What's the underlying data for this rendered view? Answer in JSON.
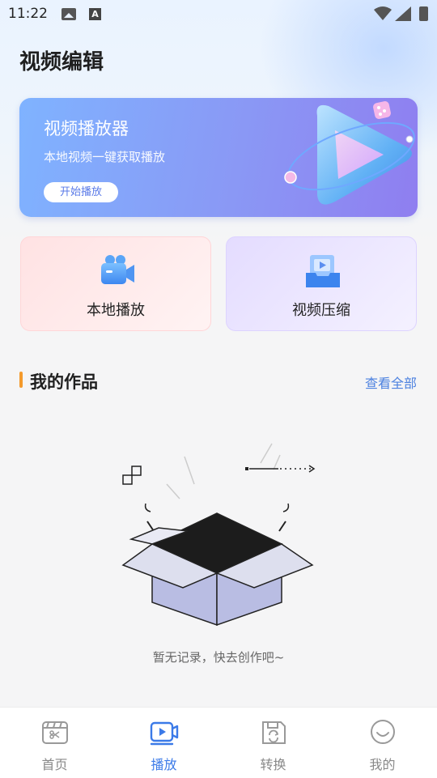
{
  "status_bar": {
    "time": "11:22",
    "indicator_letter": "A"
  },
  "page_title": "视频编辑",
  "banner": {
    "title": "视频播放器",
    "subtitle": "本地视频一键获取播放",
    "button_label": "开始播放"
  },
  "cards": [
    {
      "label": "本地播放",
      "icon": "video-camera-icon"
    },
    {
      "label": "视频压缩",
      "icon": "compress-icon"
    }
  ],
  "works": {
    "title": "我的作品",
    "view_all": "查看全部",
    "empty_text": "暂无记录，快去创作吧~"
  },
  "bottom_nav": {
    "active_index": 1,
    "items": [
      {
        "label": "首页",
        "icon": "clapperboard-icon"
      },
      {
        "label": "播放",
        "icon": "play-icon"
      },
      {
        "label": "转换",
        "icon": "convert-icon"
      },
      {
        "label": "我的",
        "icon": "smile-icon"
      }
    ]
  },
  "colors": {
    "accent": "#3b7ae8",
    "link": "#4d82e0",
    "section_marker": "#f49a2c",
    "banner_start": "#7fb3ff",
    "banner_end": "#8f7ef0"
  }
}
